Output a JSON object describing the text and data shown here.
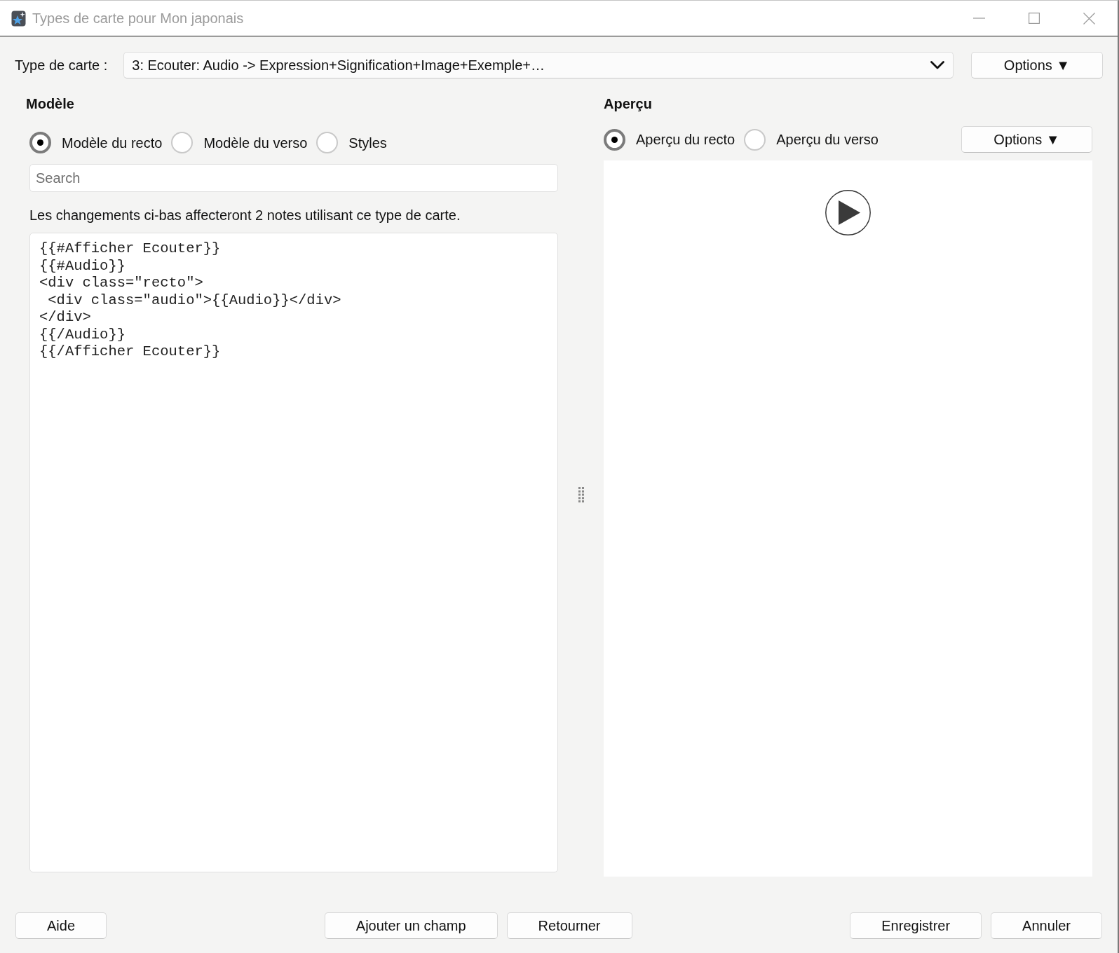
{
  "window": {
    "title": "Types de carte pour Mon japonais"
  },
  "card_type": {
    "label": "Type de carte :",
    "value": "3: Ecouter: Audio -> Expression+Signification+Image+Exemple+…",
    "options_button": "Options ▼"
  },
  "template": {
    "heading": "Modèle",
    "radios": [
      {
        "label": "Modèle du recto",
        "selected": true
      },
      {
        "label": "Modèle du verso",
        "selected": false
      },
      {
        "label": "Styles",
        "selected": false
      }
    ],
    "search": {
      "placeholder": "Search"
    },
    "info": "Les changements ci-bas affecteront 2 notes utilisant ce type de carte.",
    "code_lines": [
      "{{#Afficher Ecouter}}",
      "{{#Audio}}",
      "<div class=\"recto\">",
      " <div class=\"audio\">{{Audio}}</div>",
      "</div>",
      "{{/Audio}}",
      "{{/Afficher Ecouter}}"
    ]
  },
  "preview": {
    "heading": "Aperçu",
    "radios": [
      {
        "label": "Aperçu du recto",
        "selected": true
      },
      {
        "label": "Aperçu du verso",
        "selected": false
      }
    ],
    "options_button": "Options ▼"
  },
  "footer": {
    "left_buttons": [
      "Aide"
    ],
    "middle_buttons": [
      "Ajouter un champ",
      "Retourner"
    ],
    "right_buttons": [
      "Enregistrer",
      "Annuler"
    ]
  }
}
